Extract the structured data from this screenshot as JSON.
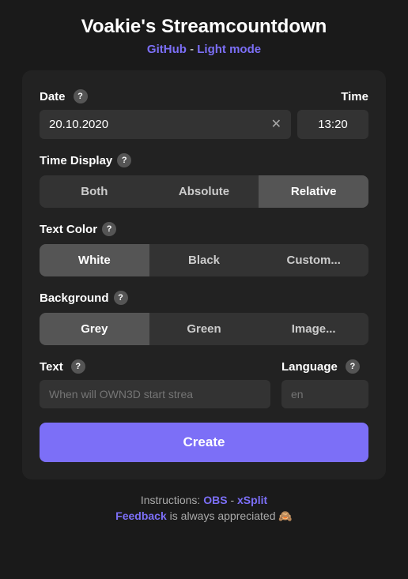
{
  "page": {
    "title": "Voakie's Streamcountdown",
    "links": {
      "github": "GitHub",
      "separator": " - ",
      "light_mode": "Light mode"
    }
  },
  "card": {
    "date_label": "Date",
    "time_label": "Time",
    "date_value": "20.10.2020",
    "time_value": "13:20",
    "time_display_label": "Time Display",
    "time_display_options": [
      "Both",
      "Absolute",
      "Relative"
    ],
    "time_display_active": "Relative",
    "text_color_label": "Text Color",
    "text_color_options": [
      "White",
      "Black",
      "Custom..."
    ],
    "text_color_active": "White",
    "background_label": "Background",
    "background_options": [
      "Grey",
      "Green",
      "Image..."
    ],
    "background_active": "Grey",
    "text_label": "Text",
    "text_placeholder": "When will OWN3D start strea",
    "language_label": "Language",
    "language_placeholder": "en",
    "create_label": "Create"
  },
  "footer": {
    "instructions_text": "Instructions:",
    "obs_label": "OBS",
    "separator": " - ",
    "xsplit_label": "xSplit",
    "feedback_text": "Feedback",
    "feedback_suffix": " is always appreciated 🙈"
  },
  "icons": {
    "help": "?",
    "clear": "✕"
  }
}
